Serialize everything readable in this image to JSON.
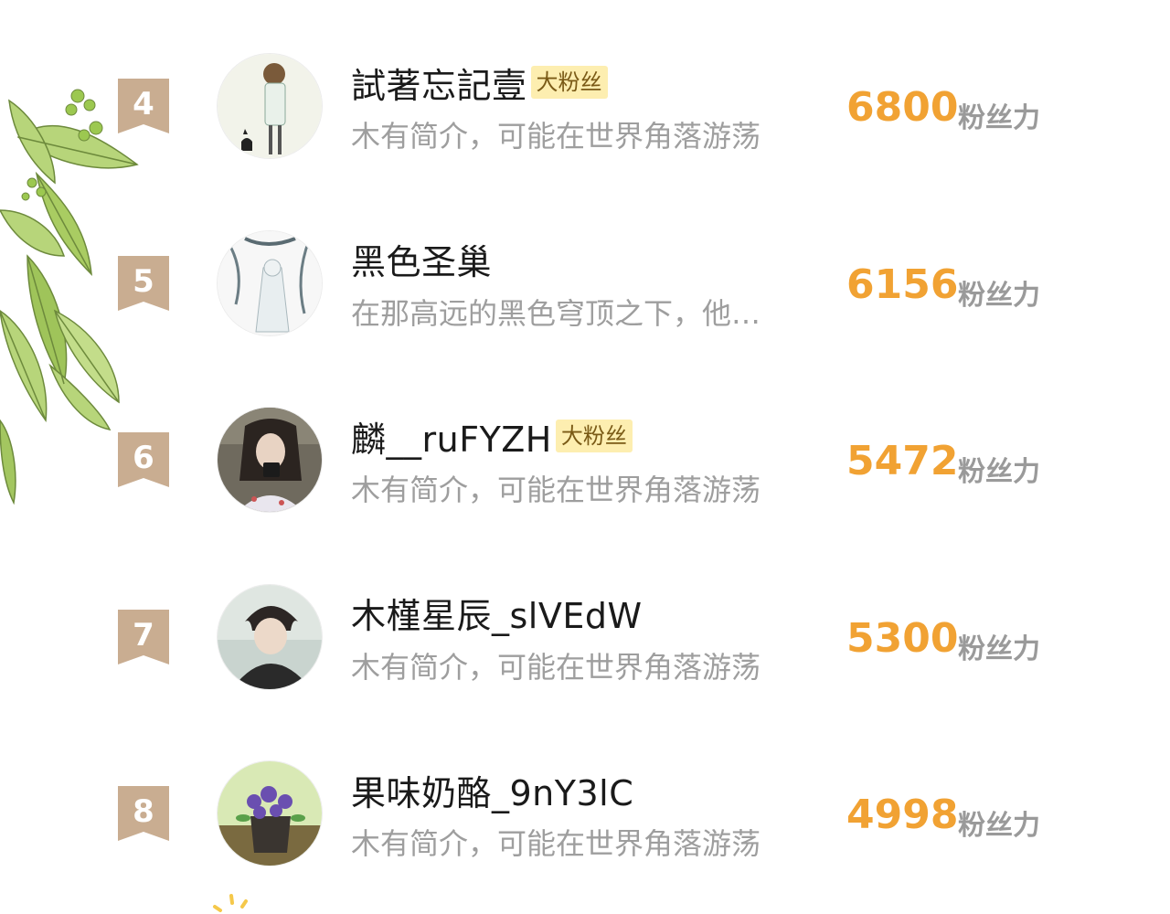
{
  "colors": {
    "rank_flag": "#c9ad91",
    "badge_bg": "#fdeeb0",
    "fan_value": "#f1a233"
  },
  "ranking": [
    {
      "rank": "4",
      "name": "試著忘記壹",
      "badge": "大粉丝",
      "intro": "木有简介，可能在世界角落游荡",
      "fan_value": "6800",
      "fan_unit": "粉丝力",
      "avatar_icon": "girl-with-cat-avatar"
    },
    {
      "rank": "5",
      "name": "黑色圣巢",
      "badge": "",
      "intro": "在那高远的黑色穹顶之下，他…",
      "fan_value": "6156",
      "fan_unit": "粉丝力",
      "avatar_icon": "white-haired-figure-avatar"
    },
    {
      "rank": "6",
      "name": "麟__ruFYZH",
      "badge": "大粉丝",
      "intro": "木有简介，可能在世界角落游荡",
      "fan_value": "5472",
      "fan_unit": "粉丝力",
      "avatar_icon": "girl-with-phone-avatar"
    },
    {
      "rank": "7",
      "name": "木槿星辰_slVEdW",
      "badge": "",
      "intro": "木有简介，可能在世界角落游荡",
      "fan_value": "5300",
      "fan_unit": "粉丝力",
      "avatar_icon": "anime-boy-avatar"
    },
    {
      "rank": "8",
      "name": "果味奶酪_9nY3lC",
      "badge": "",
      "intro": "木有简介，可能在世界角落游荡",
      "fan_value": "4998",
      "fan_unit": "粉丝力",
      "avatar_icon": "violet-flowers-avatar"
    }
  ]
}
